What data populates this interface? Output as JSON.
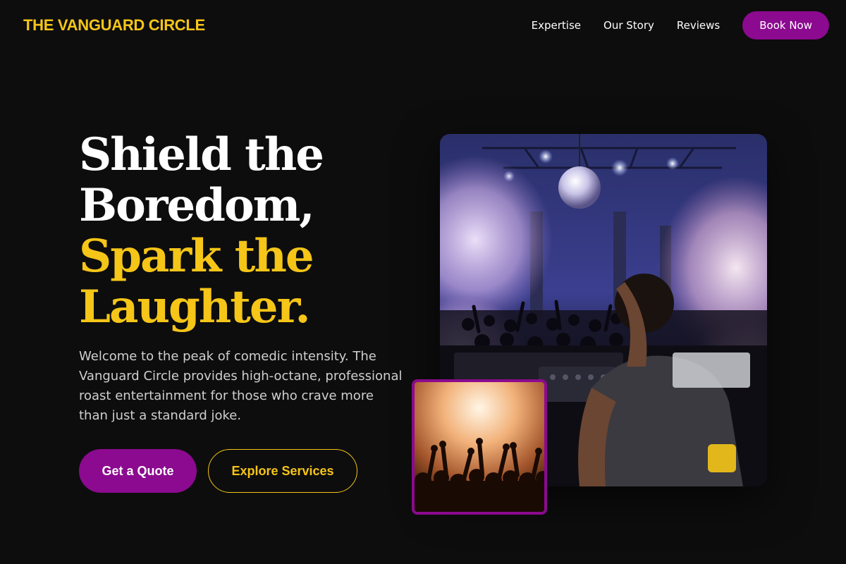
{
  "header": {
    "brand": "THE VANGUARD CIRCLE",
    "nav": [
      {
        "label": "Expertise"
      },
      {
        "label": "Our Story"
      },
      {
        "label": "Reviews"
      }
    ],
    "cta_label": "Book Now"
  },
  "hero": {
    "title_line1": "Shield the",
    "title_line2": "Boredom,",
    "title_line3": "Spark the",
    "title_line4": "Laughter.",
    "description": "Welcome to the peak of comedic intensity. The Vanguard Circle provides high-octane, professional roast entertainment for those who crave more than just a standard joke.",
    "primary_button": "Get a Quote",
    "secondary_button": "Explore Services"
  },
  "images": {
    "main_photo": "dj-club-crowd-image",
    "secondary_photo": "concert-crowd-image"
  },
  "colors": {
    "background": "#0d0d0d",
    "accent_gold": "#f5c518",
    "accent_purple": "#8b0a8f",
    "body_text": "#cfcfcf"
  }
}
